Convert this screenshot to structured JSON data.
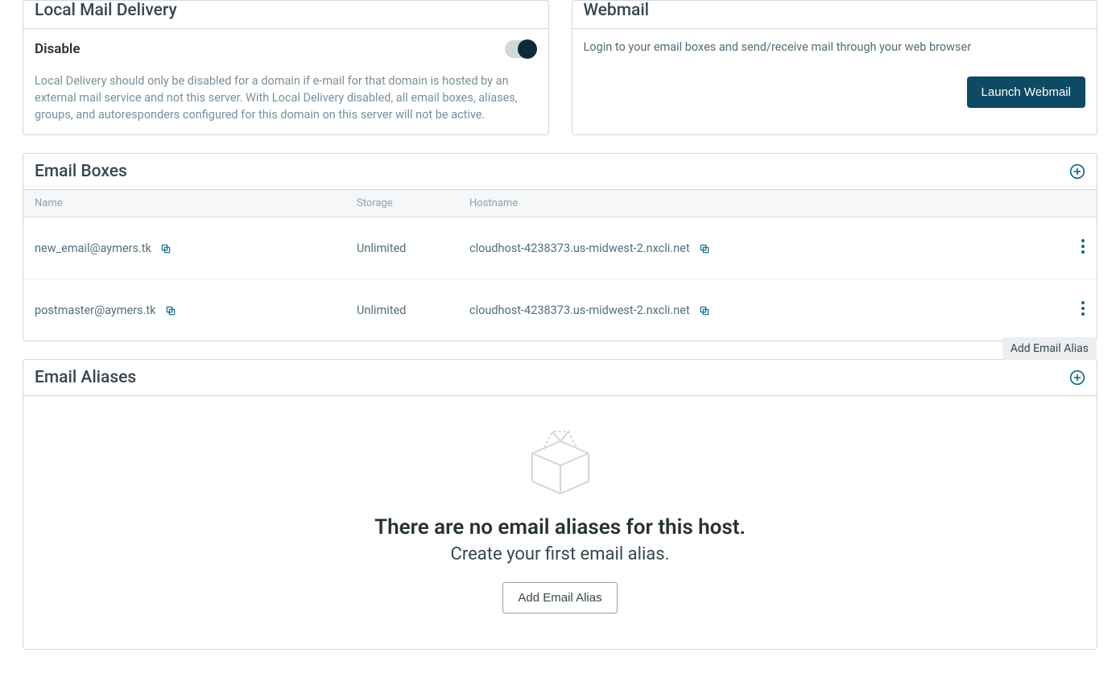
{
  "local_mail": {
    "title": "Local Mail Delivery",
    "disable_label": "Disable",
    "description": "Local Delivery should only be disabled for a domain if e-mail for that domain is hosted by an external mail service and not this server. With Local Delivery disabled, all email boxes, aliases, groups, and autoresponders configured for this domain on this server will not be active."
  },
  "webmail": {
    "title": "Webmail",
    "description": "Login to your email boxes and send/receive mail through your web browser",
    "button": "Launch Webmail"
  },
  "email_boxes": {
    "title": "Email Boxes",
    "columns": {
      "name": "Name",
      "storage": "Storage",
      "hostname": "Hostname"
    },
    "rows": [
      {
        "name": "new_email@aymers.tk",
        "storage": "Unlimited",
        "hostname": "cloudhost-4238373.us-midwest-2.nxcli.net"
      },
      {
        "name": "postmaster@aymers.tk",
        "storage": "Unlimited",
        "hostname": "cloudhost-4238373.us-midwest-2.nxcli.net"
      }
    ]
  },
  "email_aliases": {
    "title": "Email Aliases",
    "tooltip": "Add Email Alias",
    "empty_title": "There are no email aliases for this host.",
    "empty_sub": "Create your first email alias.",
    "button": "Add Email Alias"
  }
}
